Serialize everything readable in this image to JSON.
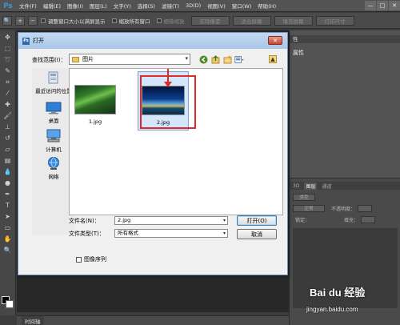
{
  "app": {
    "logo": "Ps",
    "menus": [
      "文件(F)",
      "编辑(E)",
      "图像(I)",
      "图层(L)",
      "文字(Y)",
      "选择(S)",
      "滤镜(T)",
      "3D(D)",
      "视图(V)",
      "窗口(W)",
      "帮助(H)"
    ],
    "window_controls": [
      "—",
      "□",
      "✕"
    ]
  },
  "options_bar": {
    "resize_window_label": "调整窗口大小以满屏显示",
    "zoom_all_label": "缩放所有窗口",
    "scrubby_zoom_label": "细微缩放",
    "actual_pixels": "实际像素",
    "fit_screen": "适合屏幕",
    "fill_screen": "填充屏幕",
    "print_size": "打印尺寸"
  },
  "right_panel": {
    "properties_tab": "性",
    "properties_title": "属性",
    "layers_tabs": [
      "3D",
      "图层",
      "通道"
    ],
    "kind_label": "类型",
    "blend_mode": "正常",
    "opacity_label": "不透明度：",
    "lock_label": "锁定：",
    "fill_label": "填充："
  },
  "statusbar": {
    "timeline": "时间轴"
  },
  "dialog": {
    "title": "打开",
    "ps_icon": "Ps",
    "close": "✕",
    "look_in_label": "查找范围(I)：",
    "look_in_value": "图片",
    "places": [
      {
        "label": "最近访问的位置"
      },
      {
        "label": "桌面"
      },
      {
        "label": "计算机"
      },
      {
        "label": "网络"
      }
    ],
    "files": [
      {
        "name": "1.jpg"
      },
      {
        "name": "2.jpg",
        "selected": true
      }
    ],
    "file_name_label": "文件名(N)：",
    "file_name_value": "2.jpg",
    "file_type_label": "文件类型(T)：",
    "file_type_value": "所有格式",
    "open_button": "打开(O)",
    "cancel_button": "取消",
    "image_sequence_label": "图像序列"
  },
  "watermark": {
    "text": "Bai du 经验",
    "url": "jingyan.baidu.com"
  },
  "colors": {
    "annotation_red": "#e1292a",
    "ps_dark": "#3c3c3c",
    "dialog_bg": "#f0f0f0"
  }
}
